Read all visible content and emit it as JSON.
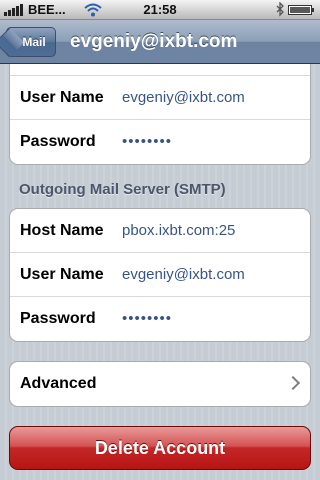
{
  "status_bar": {
    "carrier": "BEE...",
    "time": "21:58"
  },
  "nav": {
    "back_label": "Mail",
    "title": "evgeniy@ixbt.com"
  },
  "incoming_section": {
    "rows": [
      {
        "label": "User Name",
        "value": "evgeniy@ixbt.com"
      },
      {
        "label": "Password",
        "value": "••••••••"
      }
    ]
  },
  "outgoing_section": {
    "header": "Outgoing Mail Server (SMTP)",
    "rows": [
      {
        "label": "Host Name",
        "value": "pbox.ixbt.com:25"
      },
      {
        "label": "User Name",
        "value": "evgeniy@ixbt.com"
      },
      {
        "label": "Password",
        "value": "••••••••"
      }
    ]
  },
  "advanced": {
    "label": "Advanced"
  },
  "delete_button": {
    "label": "Delete Account"
  },
  "icons": [
    "signal-icon",
    "wifi-icon",
    "bluetooth-icon",
    "battery-icon",
    "chevron-right-icon"
  ]
}
